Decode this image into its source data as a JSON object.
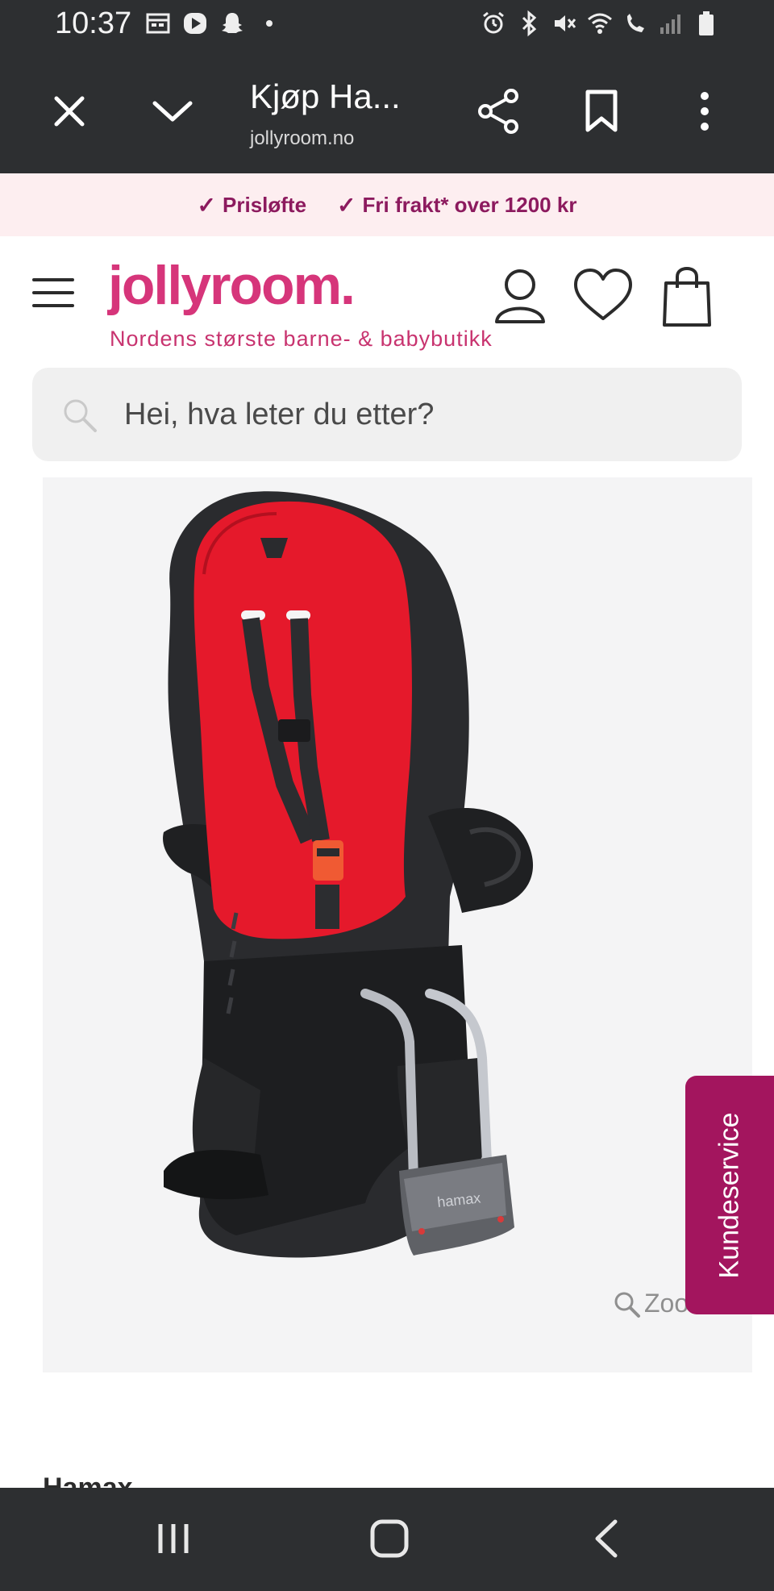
{
  "status_bar": {
    "time": "10:37",
    "left_icons": [
      "calendar-icon",
      "play-icon",
      "snapchat-icon",
      "dot-icon"
    ],
    "right_icons": [
      "alarm-icon",
      "bluetooth-icon",
      "mute-icon",
      "wifi-icon",
      "wifi-calling-icon",
      "signal-icon",
      "battery-icon"
    ]
  },
  "browser": {
    "title": "Kjøp Ha...",
    "url": "jollyroom.no",
    "icons": [
      "close-icon",
      "chevron-down-icon",
      "share-icon",
      "bookmark-icon",
      "more-vertical-icon"
    ]
  },
  "promo": {
    "items": [
      "Prisløfte",
      "Fri frakt* over 1200 kr"
    ]
  },
  "header": {
    "logo": "jollyroom.",
    "tagline": "Nordens største barne- & babybutikk"
  },
  "search": {
    "placeholder": "Hei, hva leter du etter?"
  },
  "product": {
    "zoom_label": "Zoom"
  },
  "support": {
    "label": "Kundeservice"
  },
  "brand_peek": {
    "text": "Hamax"
  },
  "colors": {
    "chrome": "#2d2f31",
    "promo_bg": "#fdeef0",
    "promo_text": "#8c1a5e",
    "brand_pink": "#d6357a",
    "support_tab": "#a3155e"
  }
}
